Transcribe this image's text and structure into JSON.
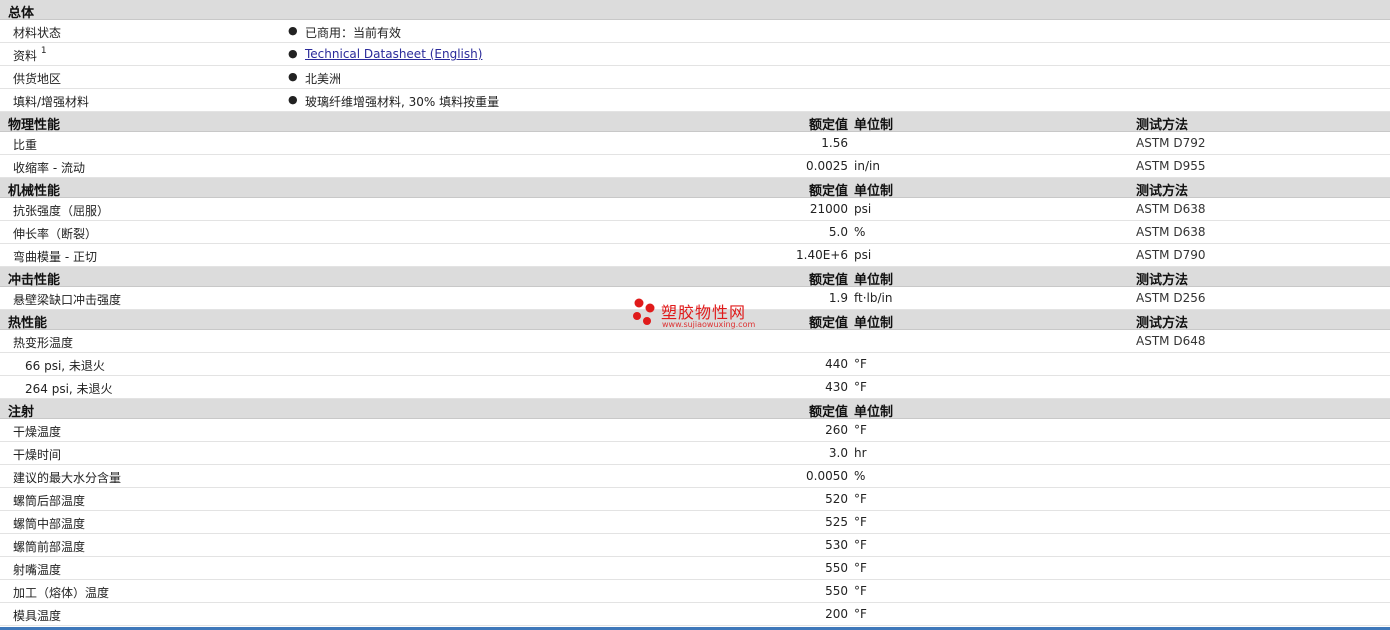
{
  "headers": {
    "value": "额定值",
    "unit": "单位制",
    "test": "测试方法"
  },
  "general": {
    "title": "总体",
    "rows": [
      {
        "label": "材料状态",
        "value": "已商用：当前有效"
      },
      {
        "label": "资料",
        "sup": "1",
        "value": "Technical Datasheet (English)",
        "link": true
      },
      {
        "label": "供货地区",
        "value": "北美洲"
      },
      {
        "label": "填料/增强材料",
        "value": "玻璃纤维增强材料, 30% 填料按重量"
      }
    ]
  },
  "sections": [
    {
      "title": "物理性能",
      "show_test": true,
      "rows": [
        {
          "label": "比重",
          "value": "1.56",
          "unit": "",
          "test": "ASTM D792"
        },
        {
          "label": "收缩率 - 流动",
          "value": "0.0025",
          "unit": "in/in",
          "test": "ASTM D955"
        }
      ]
    },
    {
      "title": "机械性能",
      "show_test": true,
      "rows": [
        {
          "label": "抗张强度（屈服）",
          "value": "21000",
          "unit": "psi",
          "test": "ASTM D638"
        },
        {
          "label": "伸长率（断裂）",
          "value": "5.0",
          "unit": "%",
          "test": "ASTM D638"
        },
        {
          "label": "弯曲模量 - 正切",
          "value": "1.40E+6",
          "unit": "psi",
          "test": "ASTM D790"
        }
      ]
    },
    {
      "title": "冲击性能",
      "show_test": true,
      "rows": [
        {
          "label": "悬壁梁缺口冲击强度",
          "value": "1.9",
          "unit": "ft·lb/in",
          "test": "ASTM D256"
        }
      ]
    },
    {
      "title": "热性能",
      "show_test": true,
      "rows": [
        {
          "label": "热变形温度",
          "value": "",
          "unit": "",
          "test": "ASTM D648"
        },
        {
          "label": "66 psi, 未退火",
          "indent": true,
          "value": "440",
          "unit": "°F",
          "test": ""
        },
        {
          "label": "264 psi, 未退火",
          "indent": true,
          "value": "430",
          "unit": "°F",
          "test": ""
        }
      ]
    },
    {
      "title": "注射",
      "show_test": false,
      "rows": [
        {
          "label": "干燥温度",
          "value": "260",
          "unit": "°F",
          "test": ""
        },
        {
          "label": "干燥时间",
          "value": "3.0",
          "unit": "hr",
          "test": ""
        },
        {
          "label": "建议的最大水分含量",
          "value": "0.0050",
          "unit": "%",
          "test": ""
        },
        {
          "label": "螺筒后部温度",
          "value": "520",
          "unit": "°F",
          "test": ""
        },
        {
          "label": "螺筒中部温度",
          "value": "525",
          "unit": "°F",
          "test": ""
        },
        {
          "label": "螺筒前部温度",
          "value": "530",
          "unit": "°F",
          "test": ""
        },
        {
          "label": "射嘴温度",
          "value": "550",
          "unit": "°F",
          "test": ""
        },
        {
          "label": "加工（熔体）温度",
          "value": "550",
          "unit": "°F",
          "test": ""
        },
        {
          "label": "模具温度",
          "value": "200",
          "unit": "°F",
          "test": ""
        }
      ]
    }
  ],
  "watermark": {
    "text": "塑胶物性网",
    "url": "www.sujiaowuxing.com",
    "color": "#e01b1b"
  },
  "colors": {
    "section_bg": "#dcdcdc",
    "link": "#2a2a9a",
    "bottom_bar": "#3f78ba"
  }
}
